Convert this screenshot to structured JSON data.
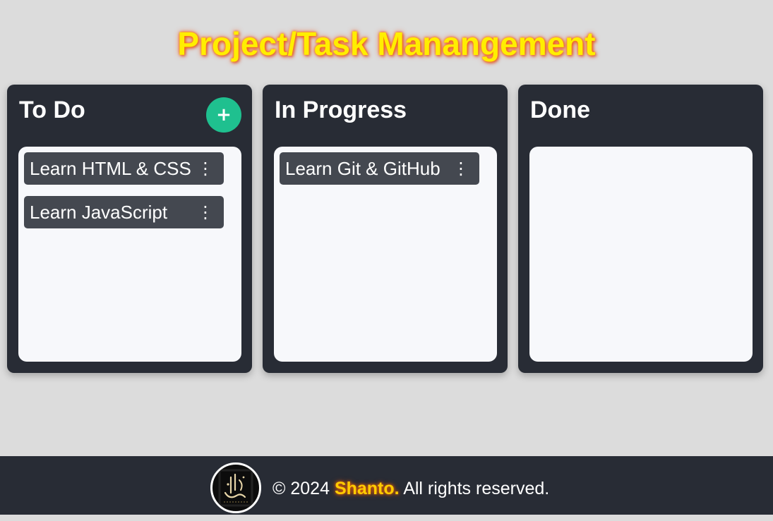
{
  "page": {
    "title": "Project/Task Manangement"
  },
  "columns": [
    {
      "title": "To Do",
      "add_label": "+",
      "tasks": [
        {
          "text": "Learn HTML & CSS"
        },
        {
          "text": "Learn JavaScript"
        }
      ]
    },
    {
      "title": "In Progress",
      "tasks": [
        {
          "text": "Learn Git & GitHub"
        }
      ]
    },
    {
      "title": "Done",
      "tasks": []
    }
  ],
  "task_menu_icon": "⋮",
  "footer": {
    "copyright": "© 2024",
    "brand": "Shanto.",
    "rights": "All rights reserved."
  },
  "colors": {
    "background": "#dcdcdc",
    "column": "#282c35",
    "task": "#444850",
    "accent_add": "#1fc08f",
    "title": "#ffee00",
    "brand": "#ffcc00"
  },
  "icons": {
    "add": "plus-icon",
    "task_menu": "kebab-menu-icon",
    "logo": "calligraphy-logo"
  }
}
